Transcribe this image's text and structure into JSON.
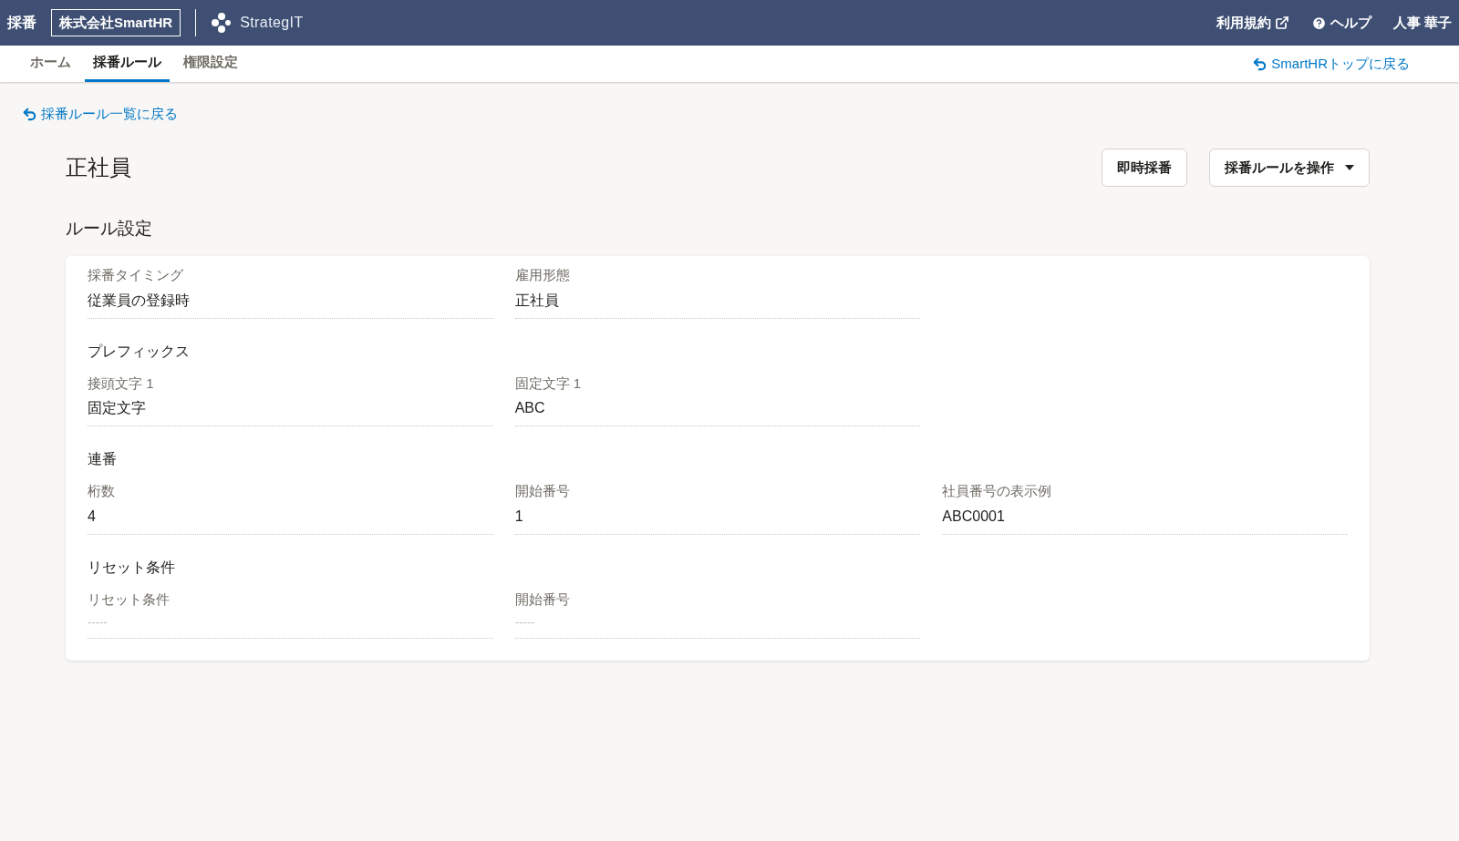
{
  "header": {
    "app_name": "採番",
    "company": "株式会社SmartHR",
    "logo_text": "StrategIT",
    "links": [
      {
        "kind": "external",
        "label": "利用規約"
      },
      {
        "kind": "help",
        "label": "ヘルプ"
      },
      {
        "kind": "user",
        "label": "人事 華子"
      }
    ]
  },
  "tabs": [
    {
      "label": "ホーム",
      "selected": false
    },
    {
      "label": "採番ルール",
      "selected": true
    },
    {
      "label": "権限設定",
      "selected": false
    }
  ],
  "top_link": "SmartHRトップに戻る",
  "back_link": "採番ルール一覧に戻る",
  "page_title": "正社員",
  "actions": [
    {
      "label": "即時採番",
      "dropdown": false
    },
    {
      "label": "採番ルールを操作",
      "dropdown": true
    }
  ],
  "section_title": "ルール設定",
  "groups": [
    {
      "fields": [
        {
          "label": "採番タイミング",
          "value": "従業員の登録時",
          "empty": false
        },
        {
          "label": "雇用形態",
          "value": "正社員",
          "empty": false
        }
      ]
    },
    {
      "heading": "プレフィックス",
      "fields": [
        {
          "label": "接頭文字 1",
          "value": "固定文字",
          "empty": false
        },
        {
          "label": "固定文字 1",
          "value": "ABC",
          "empty": false
        }
      ]
    },
    {
      "heading": "連番",
      "fields": [
        {
          "label": "桁数",
          "value": "4",
          "empty": false
        },
        {
          "label": "開始番号",
          "value": "1",
          "empty": false
        },
        {
          "label": "社員番号の表示例",
          "value": "ABC0001",
          "empty": false
        }
      ]
    },
    {
      "heading": "リセット条件",
      "fields": [
        {
          "label": "リセット条件",
          "value": "-----",
          "empty": true
        },
        {
          "label": "開始番号",
          "value": "-----",
          "empty": true
        }
      ]
    }
  ]
}
